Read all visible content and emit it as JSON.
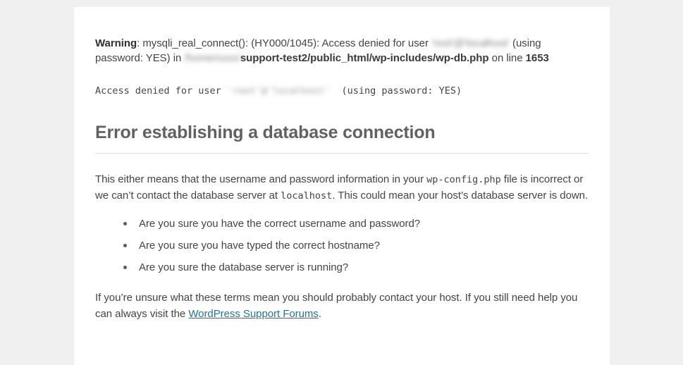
{
  "page": {
    "background_color": "#f0f0f0",
    "card_background": "#ffffff"
  },
  "php_warning": {
    "label": "Warning",
    "colon_fn": ": mysqli_real_connect(): (HY000/1045): Access denied for user ",
    "redacted_user": "'root'@'localhost'",
    "after_user": " (using password: YES) in ",
    "redacted_path": "/home/xxxx/",
    "bold_path": "support-test2/public_html/wp-includes/wp-db.php",
    "on_line": " on line ",
    "line_number": "1653"
  },
  "mono_message": {
    "prefix": "Access denied for user ",
    "redacted_user": "'root'@'localhost'",
    "suffix": "  (using password: YES)"
  },
  "heading": {
    "title": "Error establishing a database connection"
  },
  "intro": {
    "part1": "This either means that the username and password information in your ",
    "code1": "wp-config.php",
    "part2": " file is incorrect or we can’t contact the database server at ",
    "code2": "localhost",
    "part3": ". This could mean your host’s database server is down."
  },
  "checklist": {
    "items": [
      "Are you sure you have the correct username and password?",
      "Are you sure you have typed the correct hostname?",
      "Are you sure the database server is running?"
    ]
  },
  "closing": {
    "part1": "If you’re unsure what these terms mean you should probably contact your host. If you still need help you can always visit the ",
    "link_text": "WordPress Support Forums",
    "part2": ".",
    "link_color": "#21759b"
  }
}
